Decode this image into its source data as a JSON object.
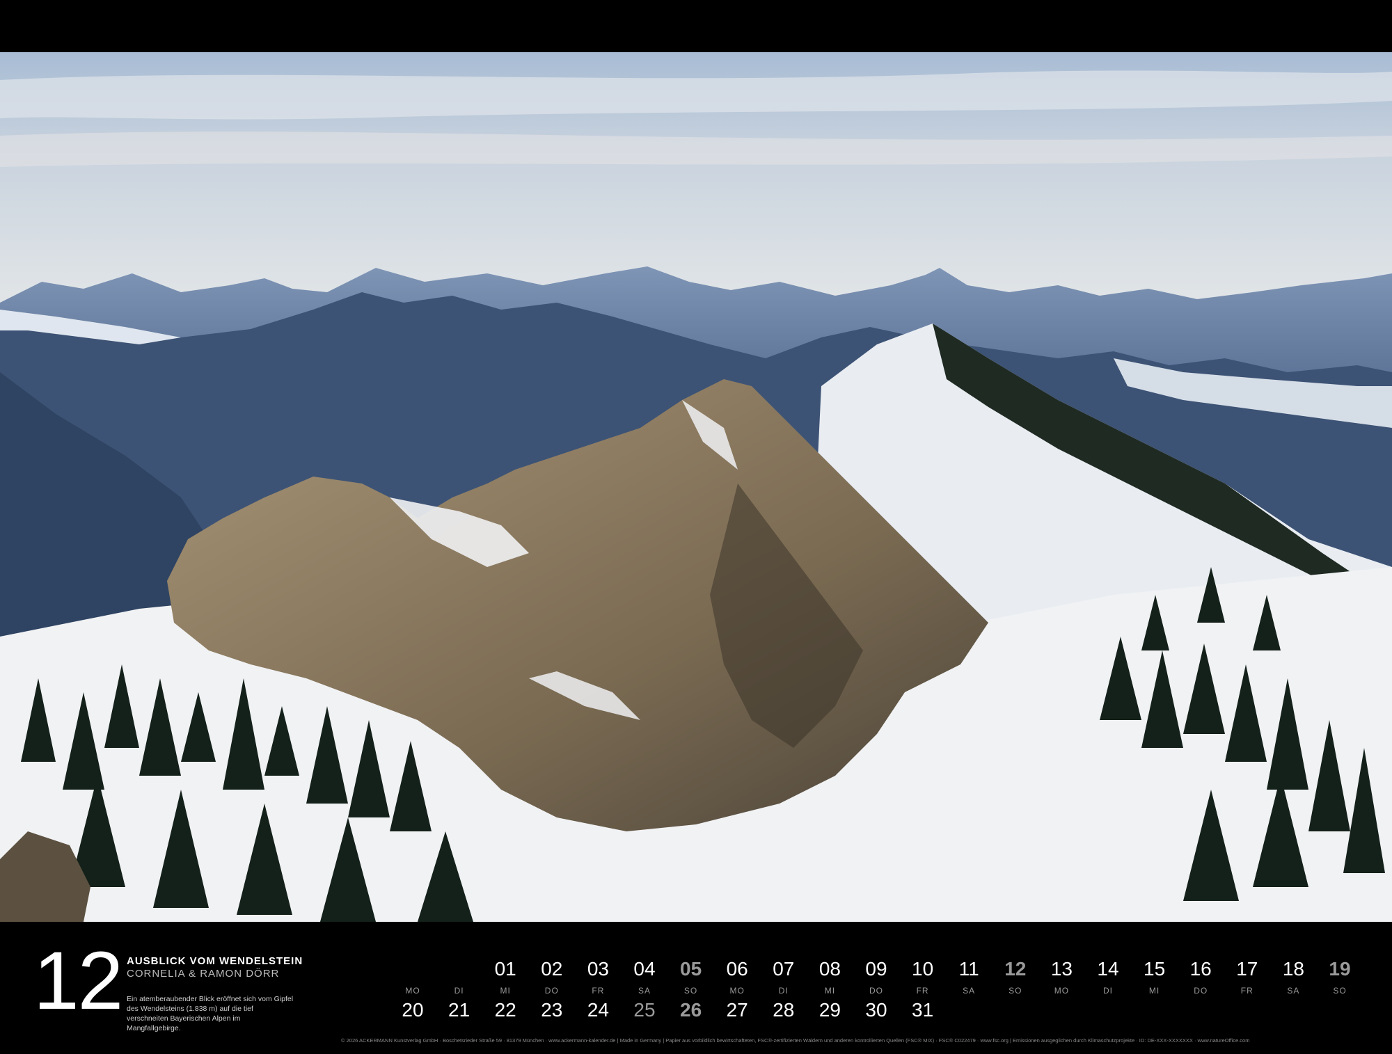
{
  "month": "12",
  "title": "AUSBLICK VOM WENDELSTEIN",
  "author": "CORNELIA & RAMON DÖRR",
  "description": "Ein atemberaubender Blick eröffnet sich vom Gipfel des Wendelsteins (1.838 m) auf die tief verschneiten Bayerischen Alpen im Mangfallgebirge.",
  "weekdays": [
    "MO",
    "DI",
    "MI",
    "DO",
    "FR",
    "SA",
    "SO",
    "MO",
    "DI",
    "MI",
    "DO",
    "FR",
    "SA",
    "SO",
    "MO",
    "DI",
    "MI",
    "DO",
    "FR",
    "SA",
    "SO"
  ],
  "row1": [
    "01",
    "02",
    "03",
    "04",
    "05",
    "06",
    "07",
    "08",
    "09",
    "10",
    "11",
    "12",
    "13",
    "14",
    "15",
    "16",
    "17",
    "18",
    "19"
  ],
  "row2": [
    "20",
    "21",
    "22",
    "23",
    "24",
    "25",
    "26",
    "27",
    "28",
    "29",
    "30",
    "31"
  ],
  "imprint": "© 2026 ACKERMANN Kunstverlag GmbH · Boschetsrieder Straße 59 · 81379 München · www.ackermann-kalender.de   |   Made in Germany   |   Papier aus vorbildlich bewirtschafteten, FSC®-zertifizierten Wäldern und anderen kontrollierten Quellen (FSC® MIX) · FSC® C022479 · www.fsc.org   |   Emissionen ausgeglichen durch Klimaschutzprojekte · ID: DE-XXX-XXXXXXX · www.natureOffice.com",
  "colors": {
    "sky_top": "#9fb4cf",
    "sky_bottom": "#e9ecee",
    "mountain_far": "#6f86a8",
    "mountain_mid": "#3f5678",
    "snow": "#f3f4f6",
    "rock": "#8b7a60",
    "tree": "#14211a"
  }
}
